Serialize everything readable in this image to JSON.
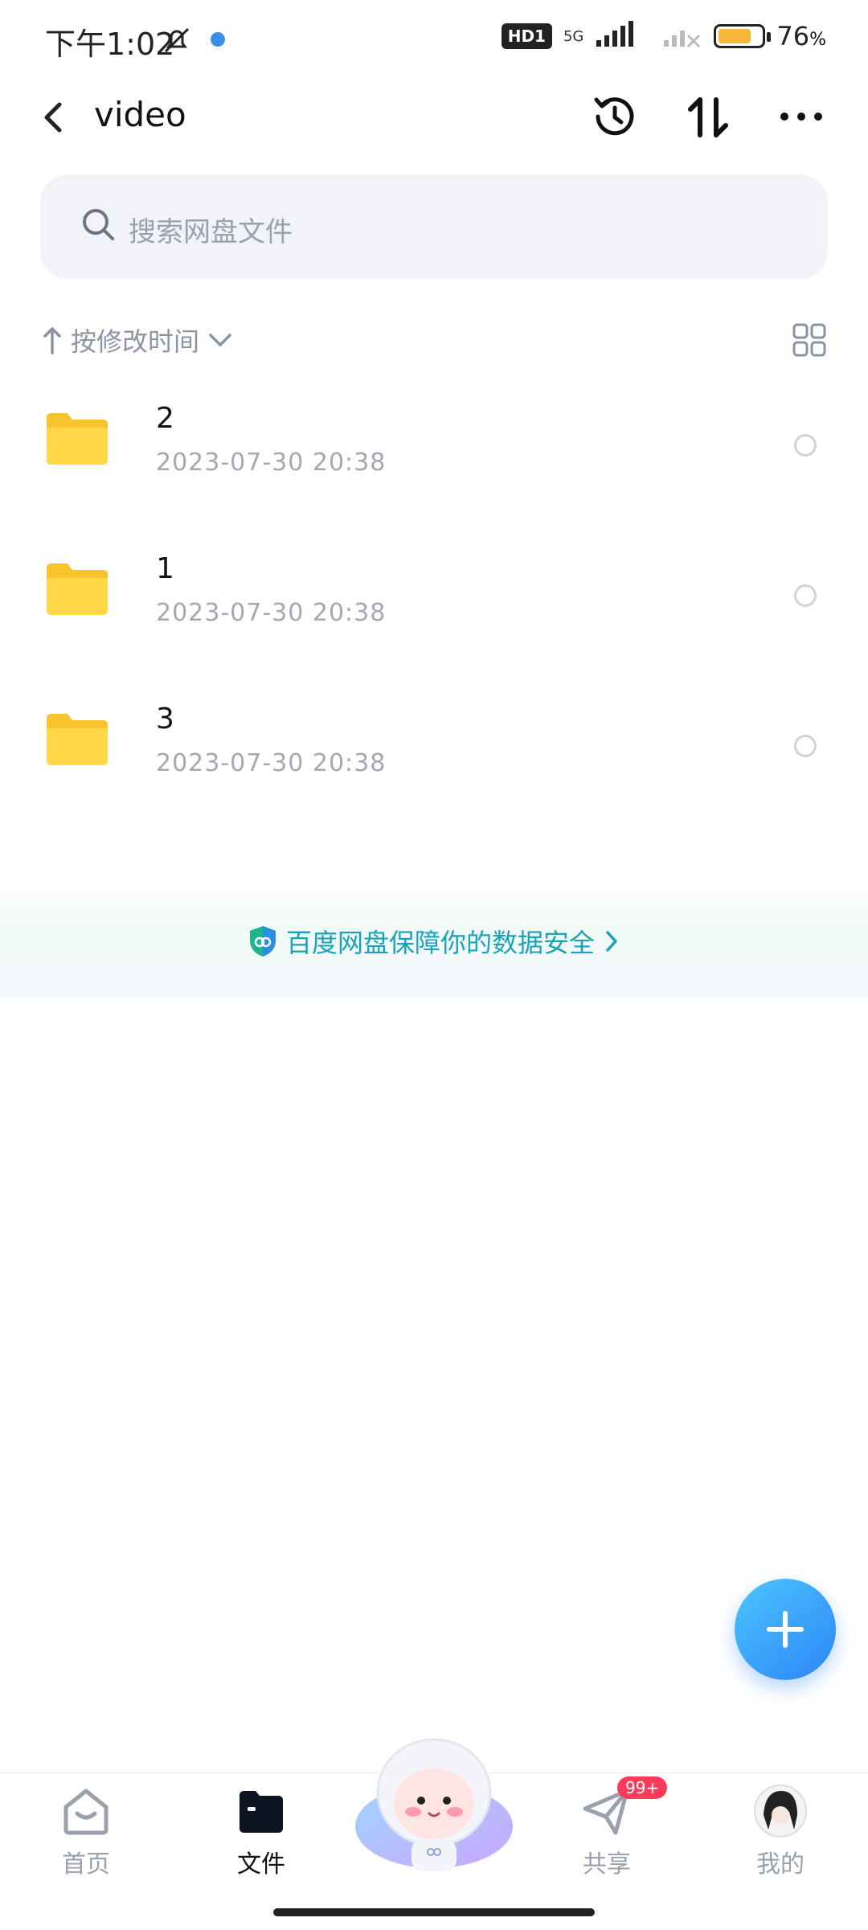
{
  "status_bar": {
    "time": "下午1:02",
    "hd_label": "HD1",
    "network_label": "5G",
    "battery_percent": "76",
    "battery_suffix": "%",
    "battery_level": 0.76
  },
  "header": {
    "title": "video"
  },
  "search": {
    "placeholder": "搜索网盘文件"
  },
  "sort": {
    "label": "按修改时间"
  },
  "files": [
    {
      "name": "2",
      "date": "2023-07-30  20:38"
    },
    {
      "name": "1",
      "date": "2023-07-30  20:38"
    },
    {
      "name": "3",
      "date": "2023-07-30  20:38"
    }
  ],
  "banner": {
    "text": "百度网盘保障你的数据安全"
  },
  "bottom_nav": {
    "items": [
      {
        "label": "首页",
        "icon": "home-icon"
      },
      {
        "label": "文件",
        "icon": "folder-icon"
      },
      {
        "label": "共享",
        "icon": "send-icon",
        "badge": "99+"
      },
      {
        "label": "我的",
        "icon": "avatar"
      }
    ]
  },
  "colors": {
    "accent": "#2d86f5",
    "folder": "#f8c32c",
    "banner_text": "#1aa2b8",
    "badge": "#ff3b5c"
  }
}
